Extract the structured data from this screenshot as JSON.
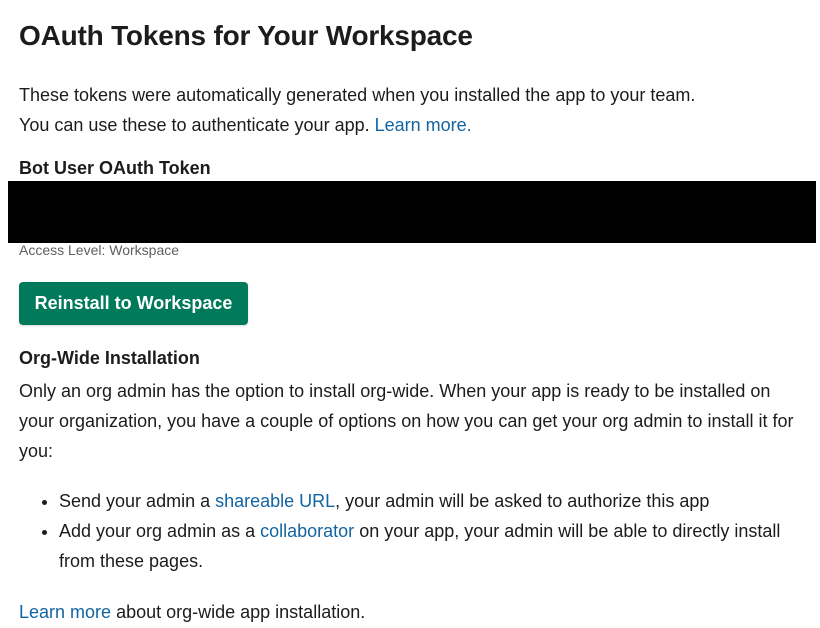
{
  "page": {
    "title": "OAuth Tokens for Your Workspace"
  },
  "intro": {
    "line1": "These tokens were automatically generated when you installed the app to your team.",
    "line2_text": "You can use these to authenticate your app. ",
    "line2_link": "Learn more."
  },
  "bot_token": {
    "label": "Bot User OAuth Token",
    "access_level": "Access Level: Workspace"
  },
  "reinstall_button": {
    "label": "Reinstall to Workspace"
  },
  "org_install": {
    "title": "Org-Wide Installation",
    "description": "Only an org admin has the option to install org-wide. When your app is ready to be installed on your organization, you have a couple of options on how you can get your org admin to install it for you:",
    "options": [
      {
        "before": "Send your admin a ",
        "link": "shareable URL",
        "after": ", your admin will be asked to authorize this app"
      },
      {
        "before": "Add your org admin as a ",
        "link": "collaborator",
        "after": " on your app, your admin will be able to directly install from these pages."
      }
    ]
  },
  "footer": {
    "link": "Learn more",
    "text": " about org-wide app installation."
  },
  "colors": {
    "link": "#1264a3",
    "button": "#007a5a",
    "redaction": "#000000"
  }
}
